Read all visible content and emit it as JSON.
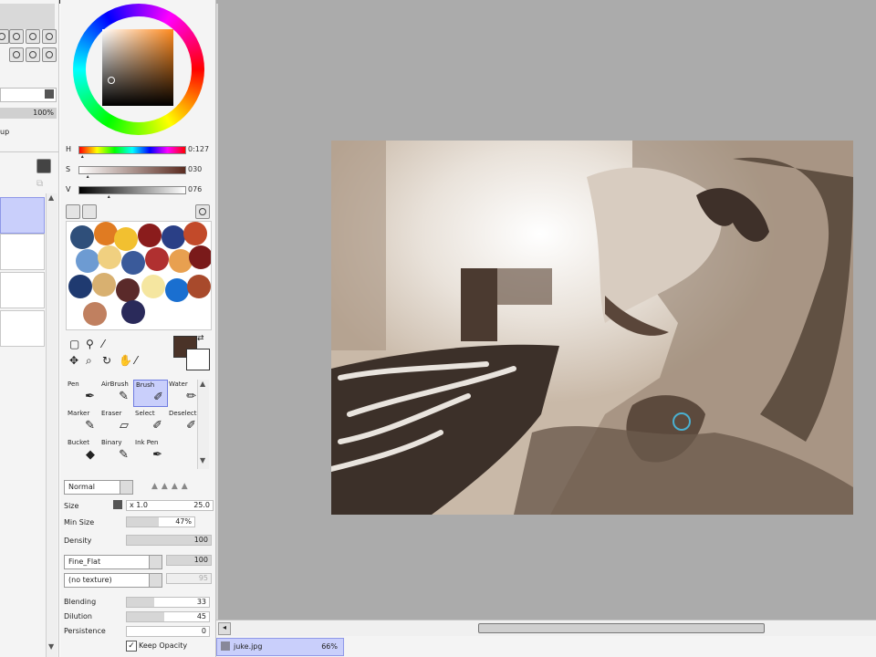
{
  "layer_panel": {
    "opacity_value": "100%",
    "group_label_fragment": "up",
    "layers": [
      {
        "selected": true
      },
      {
        "selected": false
      },
      {
        "selected": false
      },
      {
        "selected": false
      }
    ]
  },
  "color": {
    "hsv": [
      {
        "label": "H",
        "value": "0:127",
        "level": 0.05
      },
      {
        "label": "S",
        "value": "030",
        "level": 0.1
      },
      {
        "label": "V",
        "value": "076",
        "level": 0.3
      }
    ],
    "primary": "#4a3328",
    "secondary": "#ffffff",
    "swatches": [
      "#2f4f7a",
      "#e07b22",
      "#f2c030",
      "#8a1c1c",
      "#2a3f86",
      "#c24a2a",
      "#6d9bd2",
      "#f0d080",
      "#3a5a9a",
      "#b03030",
      "#e8a050",
      "#7a1a1a",
      "#1f3a70",
      "#d8b070",
      "#5a2a2a",
      "#f5e6a0",
      "#1a6fd0",
      "#a84a2c",
      "#c08060",
      "#2a2a5a"
    ]
  },
  "tools": {
    "items": [
      {
        "label": "Pen",
        "icon": "pen-icon",
        "glyph": "✒",
        "active": false
      },
      {
        "label": "AirBrush",
        "icon": "airbrush-icon",
        "glyph": "✎",
        "active": false
      },
      {
        "label": "Brush",
        "icon": "brush-icon",
        "glyph": "✐",
        "active": true
      },
      {
        "label": "Water",
        "icon": "water-brush-icon",
        "glyph": "✏",
        "active": false
      },
      {
        "label": "Marker",
        "icon": "marker-icon",
        "glyph": "✎",
        "active": false
      },
      {
        "label": "Eraser",
        "icon": "eraser-icon",
        "glyph": "▱",
        "active": false
      },
      {
        "label": "Select",
        "icon": "select-pen-icon",
        "glyph": "✐",
        "active": false
      },
      {
        "label": "Deselect",
        "icon": "deselect-pen-icon",
        "glyph": "✐",
        "active": false
      },
      {
        "label": "Bucket",
        "icon": "bucket-icon",
        "glyph": "◆",
        "active": false
      },
      {
        "label": "Binary",
        "icon": "binary-pen-icon",
        "glyph": "✎",
        "active": false
      },
      {
        "label": "Ink Pen",
        "icon": "ink-pen-icon",
        "glyph": "✒",
        "active": false
      }
    ]
  },
  "brush": {
    "blend_mode": "Normal",
    "size_multiplier": "x 1.0",
    "size_value": "25.0",
    "min_size": "47%",
    "min_size_level": 0.47,
    "density": "100",
    "density_level": 1.0,
    "brush_shape": "Fine_Flat",
    "shape_strength": "100",
    "texture": "(no texture)",
    "texture_strength": "95",
    "rows": [
      {
        "label": "Size"
      },
      {
        "label": "Min Size"
      },
      {
        "label": "Density"
      }
    ],
    "mix": [
      {
        "label": "Blending",
        "value": "33",
        "level": 0.33
      },
      {
        "label": "Dilution",
        "value": "45",
        "level": 0.45
      },
      {
        "label": "Persistence",
        "value": "0",
        "level": 0.0
      }
    ],
    "keep_opacity_label": "Keep Opacity",
    "keep_opacity_checked": true
  },
  "document": {
    "tab_name": "juke.jpg",
    "zoom": "66%"
  }
}
